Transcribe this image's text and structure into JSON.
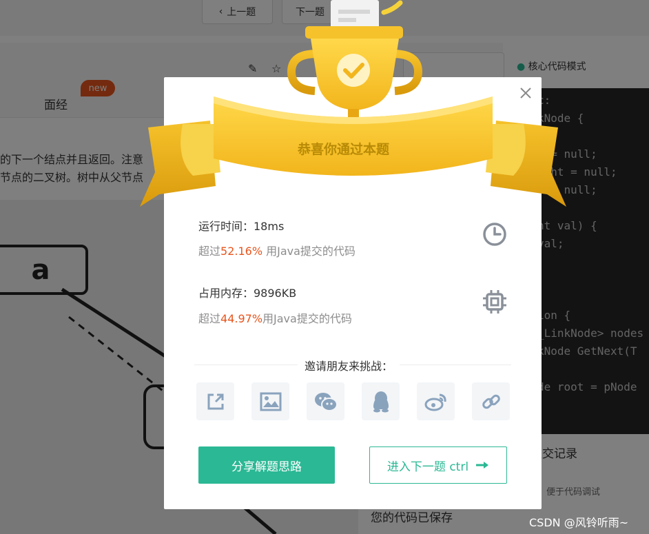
{
  "background": {
    "prev_label": "上一题",
    "next_label": "下一题",
    "tab_label": "面经",
    "new_badge": "new",
    "mode_label": "核心代码模式",
    "text_lines": [
      "的下一个结点并且返回。注意",
      "节点的二叉树。树中从父节点"
    ],
    "tree_node_label": "a",
    "code_lines": [
      "c:",
      "kNode {",
      "",
      "t = null;",
      "ight = null;",
      "t = null;",
      "",
      "nt val) {",
      "val;",
      "",
      "",
      "",
      "ion {",
      "_LinkNode> nodes",
      "kNode GetNext(T",
      "",
      "de root = pNode"
    ],
    "submit_record": "提交记录",
    "hint_text": "，便于代码调试",
    "saved_text": "您的代码已保存"
  },
  "modal": {
    "ribbon_title": "恭喜你通过本题",
    "runtime": {
      "label": "运行时间：18ms",
      "prefix": "超过",
      "percent": "52.16%",
      "suffix": " 用Java提交的代码"
    },
    "memory": {
      "label": "占用内存：9896KB",
      "prefix": "超过",
      "percent": "44.97%",
      "suffix": "用Java提交的代码"
    },
    "invite_label": "邀请朋友来挑战：",
    "share_icons": [
      "share-link-icon",
      "image-icon",
      "wechat-icon",
      "qq-icon",
      "weibo-icon",
      "link-icon"
    ],
    "share_button": "分享解题思路",
    "next_button": "进入下一题 ctrl"
  },
  "watermark": "CSDN @风铃听雨~",
  "colors": {
    "accent_green": "#2bb894",
    "highlight_orange": "#e8541c",
    "gold": "#f5c22b"
  }
}
